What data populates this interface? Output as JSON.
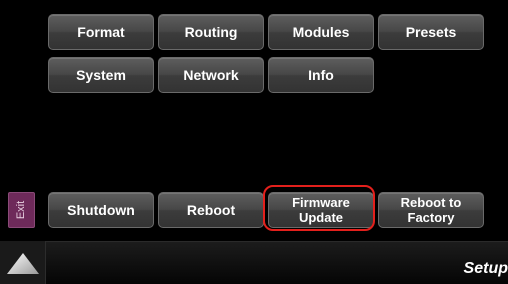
{
  "menu": {
    "format_label": "Format",
    "routing_label": "Routing",
    "modules_label": "Modules",
    "presets_label": "Presets",
    "system_label": "System",
    "network_label": "Network",
    "info_label": "Info"
  },
  "actions": {
    "exit_label": "Exit",
    "shutdown_label": "Shutdown",
    "reboot_label": "Reboot",
    "firmware_update_label": "Firmware\nUpdate",
    "reboot_factory_label": "Reboot to\nFactory"
  },
  "footer": {
    "home_icon": "triangle-up-icon",
    "page_title": "Setup"
  },
  "colors": {
    "background": "#000000",
    "button_gradient_top": "#5e5e5e",
    "button_gradient_bottom": "#333333",
    "exit_button": "#6e2a5a",
    "highlight": "#e3201c",
    "text": "#ffffff"
  }
}
